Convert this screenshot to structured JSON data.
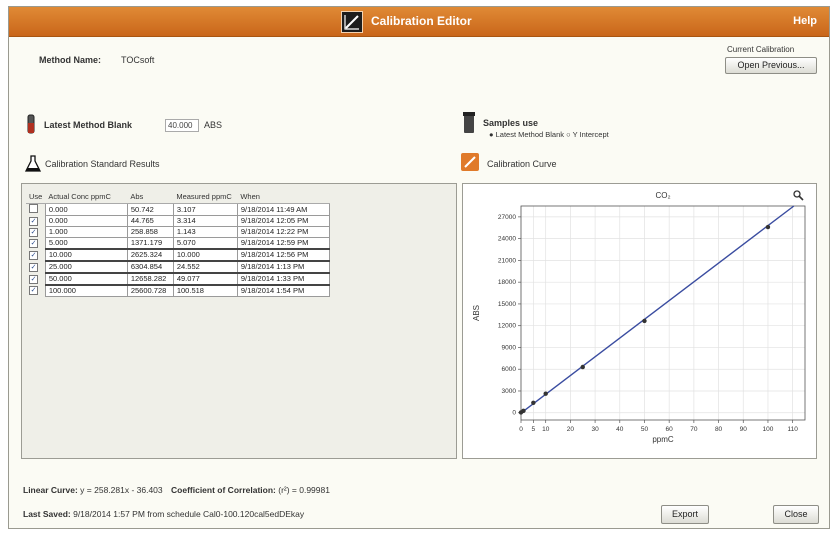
{
  "window": {
    "title": "Calibration Editor",
    "help": "Help"
  },
  "method": {
    "label": "Method Name:",
    "value": "TOCsoft"
  },
  "current_calibration": {
    "label": "Current Calibration",
    "open_button": "Open Previous..."
  },
  "blank": {
    "label": "Latest Method Blank",
    "value": "40.000",
    "unit": "ABS"
  },
  "samples": {
    "label": "Samples use",
    "option1": "Latest Method Blank",
    "option2": "Y Intercept"
  },
  "results": {
    "title": "Calibration Standard Results",
    "columns": [
      "Use",
      "Actual Conc ppmC",
      "Abs",
      "Measured ppmC",
      "When"
    ],
    "rows": [
      {
        "use": false,
        "conc": "0.000",
        "abs": "50.742",
        "meas": "3.107",
        "when": "9/18/2014 11:49 AM"
      },
      {
        "use": true,
        "conc": "0.000",
        "abs": "44.765",
        "meas": "3.314",
        "when": "9/18/2014 12:05 PM"
      },
      {
        "use": true,
        "conc": "1.000",
        "abs": "258.858",
        "meas": "1.143",
        "when": "9/18/2014 12:22 PM"
      },
      {
        "use": true,
        "conc": "5.000",
        "abs": "1371.179",
        "meas": "5.070",
        "when": "9/18/2014 12:59 PM"
      },
      {
        "use": true,
        "conc": "10.000",
        "abs": "2625.324",
        "meas": "10.000",
        "when": "9/18/2014 12:56 PM"
      },
      {
        "use": true,
        "conc": "25.000",
        "abs": "6304.854",
        "meas": "24.552",
        "when": "9/18/2014 1:13 PM"
      },
      {
        "use": true,
        "conc": "50.000",
        "abs": "12658.282",
        "meas": "49.077",
        "when": "9/18/2014 1:33 PM"
      },
      {
        "use": true,
        "conc": "100.000",
        "abs": "25600.728",
        "meas": "100.518",
        "when": "9/18/2014 1:54 PM"
      }
    ]
  },
  "curve": {
    "label": "Calibration Curve"
  },
  "chart_data": {
    "type": "scatter",
    "title": "CO₂",
    "xlabel": "ppmC",
    "ylabel": "ABS",
    "xlim": [
      0,
      115
    ],
    "ylim": [
      -1000,
      28500
    ],
    "xticks": [
      0,
      5,
      10,
      20,
      30,
      40,
      50,
      60,
      70,
      80,
      90,
      100,
      110
    ],
    "yticks": [
      0,
      3000,
      6000,
      9000,
      12000,
      15000,
      18000,
      21000,
      24000,
      27000
    ],
    "ytick_labels": [
      "0",
      "3000",
      "6000",
      "9000",
      "12000",
      "15000",
      "18000",
      "21000",
      "24000",
      "27000"
    ],
    "points": [
      [
        0,
        44.765
      ],
      [
        1,
        258.858
      ],
      [
        5,
        1371.179
      ],
      [
        10,
        2625.324
      ],
      [
        25,
        6304.854
      ],
      [
        50,
        12658.282
      ],
      [
        100,
        25600.728
      ]
    ],
    "fit": {
      "slope": 258.281,
      "intercept": -36.403
    },
    "line_color": "#3a4ca0",
    "point_color": "#333333"
  },
  "footer": {
    "linear_label": "Linear Curve:",
    "linear_value": "y = 258.281x - 36.403",
    "corr_label": "Coefficient of Correlation:",
    "corr_value": "(r²) = 0.99981",
    "saved_label": "Last Saved:",
    "saved_value": "9/18/2014 1:57 PM from schedule Cal0-100.120cal5edDEkay",
    "export_button": "Export",
    "close_button": "Close"
  },
  "colors": {
    "title_bar": "#d4752a"
  }
}
